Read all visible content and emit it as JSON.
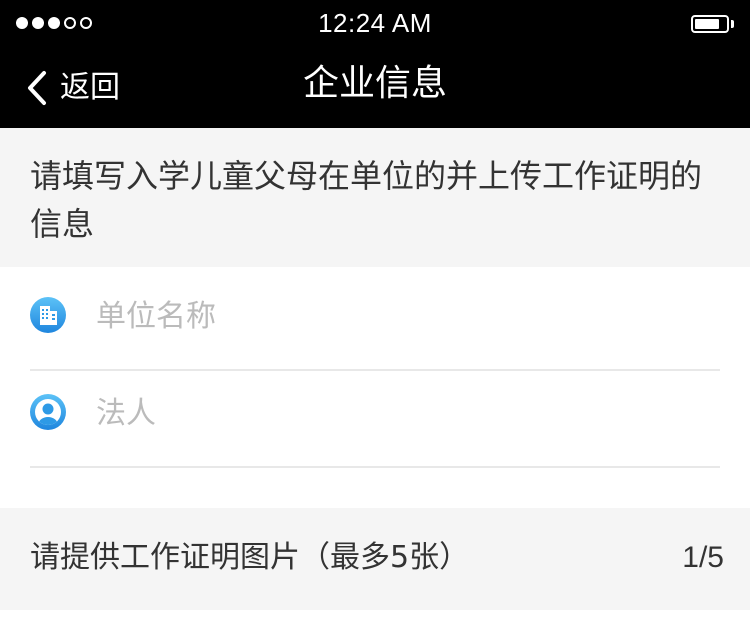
{
  "status_bar": {
    "time": "12:24 AM",
    "signal": {
      "filled_dots": 3,
      "total_dots": 5
    },
    "battery_level": 0.8
  },
  "nav": {
    "back_label": "返回",
    "title": "企业信息"
  },
  "notice": {
    "text": "请填写入学儿童父母在单位的并上传工作证明的信息"
  },
  "form": {
    "company_name": {
      "placeholder": "单位名称",
      "value": "",
      "icon": "building-icon"
    },
    "legal_person": {
      "placeholder": "法人",
      "value": "",
      "icon": "person-icon"
    }
  },
  "upload": {
    "label": "请提供工作证明图片（最多5张）",
    "count": "1/5"
  },
  "colors": {
    "bar_bg": "#000000",
    "section_bg": "#f5f5f5",
    "icon_blue": "#2e9ae6",
    "placeholder": "#bbbbbb"
  }
}
